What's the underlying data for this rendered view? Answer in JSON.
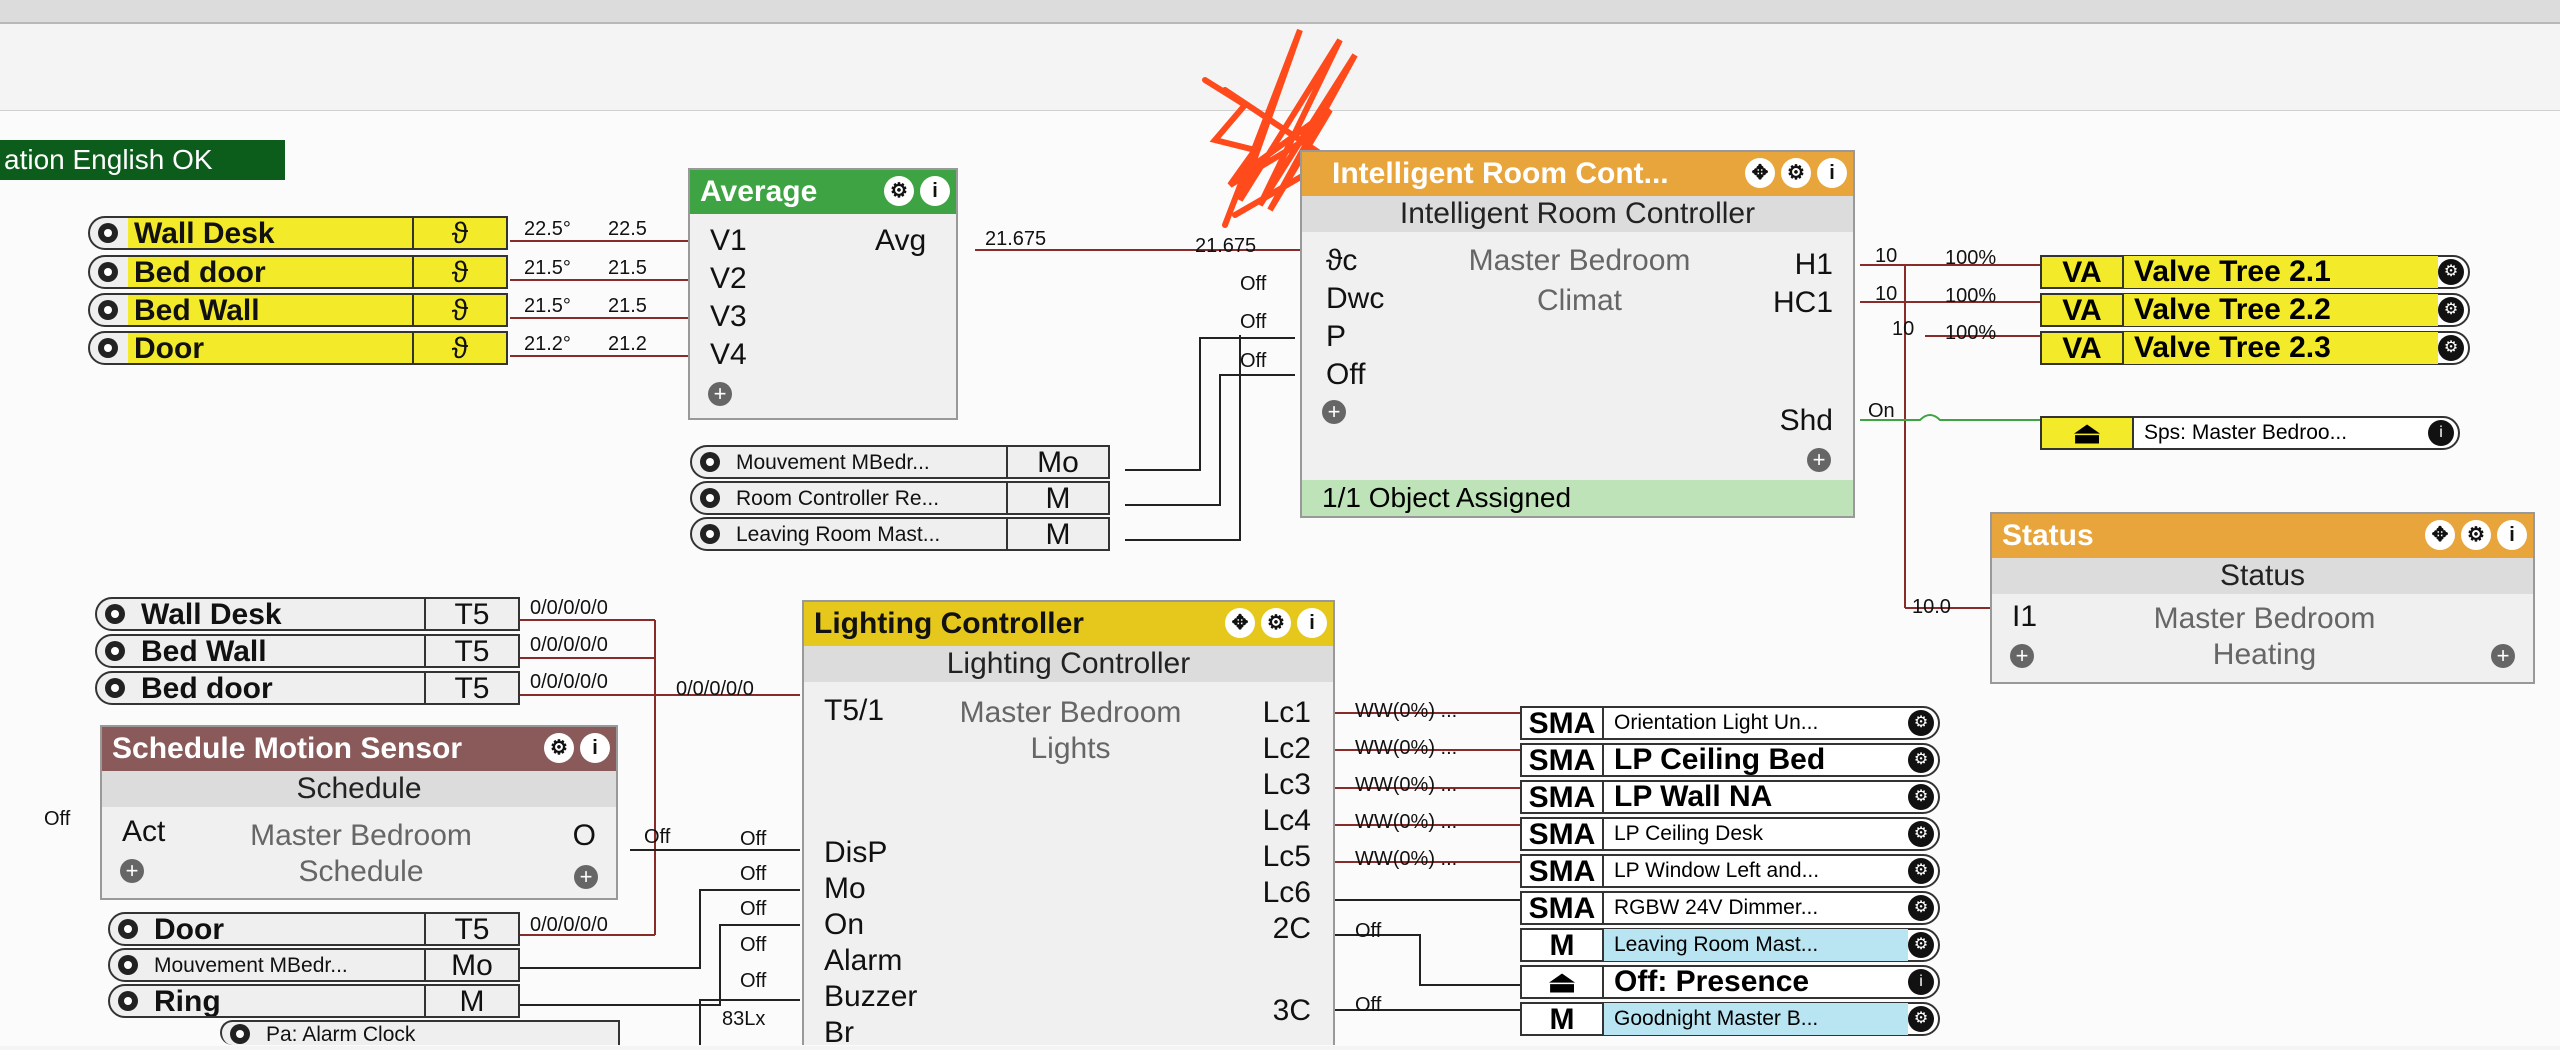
{
  "status_bar": "ation English OK",
  "temp_inputs": [
    {
      "label": "Wall Desk",
      "tag": "ϑ",
      "value": "22.5°",
      "out": "22.5"
    },
    {
      "label": "Bed door",
      "tag": "ϑ",
      "value": "21.5°",
      "out": "21.5"
    },
    {
      "label": "Bed Wall",
      "tag": "ϑ",
      "value": "21.5°",
      "out": "21.5"
    },
    {
      "label": "Door",
      "tag": "ϑ",
      "value": "21.2°",
      "out": "21.2"
    }
  ],
  "average": {
    "title": "Average",
    "inputs": [
      "V1",
      "V2",
      "V3",
      "V4"
    ],
    "output": "Avg",
    "value": "21.675"
  },
  "irc": {
    "title": "Intelligent Room Cont...",
    "subtitle": "Intelligent Room Controller",
    "room": "Master Bedroom",
    "category": "Climat",
    "inputs": [
      "ϑc",
      "Dwc",
      "P",
      "Off"
    ],
    "input_values": [
      "21.675",
      "Off",
      "Off",
      "Off"
    ],
    "outputs": [
      "H1",
      "HC1",
      "Shd"
    ],
    "footer": "1/1 Object Assigned",
    "h1_value": "10",
    "hc1_value": "10",
    "third_value": "10",
    "shd_value": "On"
  },
  "mode_inputs": [
    {
      "label": "Mouvement MBedr...",
      "tag": "Mo"
    },
    {
      "label": "Room Controller Re...",
      "tag": "M"
    },
    {
      "label": "Leaving Room Mast...",
      "tag": "M"
    }
  ],
  "valves": [
    {
      "tag": "VA",
      "label": "Valve Tree 2.1",
      "pct": "100%"
    },
    {
      "tag": "VA",
      "label": "Valve Tree 2.2",
      "pct": "100%"
    },
    {
      "tag": "VA",
      "label": "Valve Tree 2.3",
      "pct": "100%"
    }
  ],
  "sps_output": "Sps: Master Bedroo...",
  "status_block": {
    "title": "Status",
    "subtitle": "Status",
    "port": "I1",
    "room": "Master Bedroom",
    "value": "Heating",
    "input_value": "10.0"
  },
  "light_inputs": [
    {
      "label": "Wall Desk",
      "tag": "T5",
      "value": "0/0/0/0/0"
    },
    {
      "label": "Bed Wall",
      "tag": "T5",
      "value": "0/0/0/0/0"
    },
    {
      "label": "Bed door",
      "tag": "T5",
      "value": "0/0/0/0/0"
    }
  ],
  "schedule": {
    "title": "Schedule Motion Sensor",
    "subtitle": "Schedule",
    "port_in": "Act",
    "room": "Master Bedroom",
    "category": "Schedule",
    "port_out": "O",
    "in_value": "Off",
    "out_value": "Off"
  },
  "lower_inputs": [
    {
      "label": "Door",
      "tag": "T5",
      "value": "0/0/0/0/0"
    },
    {
      "label": "Mouvement MBedr...",
      "tag": "Mo"
    },
    {
      "label": "Ring",
      "tag": "M"
    }
  ],
  "lower_partial": "Pa: Alarm Clock",
  "lighting": {
    "title": "Lighting Controller",
    "subtitle": "Lighting Controller",
    "room": "Master Bedroom",
    "category": "Lights",
    "t5_port": "T5/1",
    "t5_value": "0/0/0/0/0",
    "inputs": [
      "DisP",
      "Mo",
      "On",
      "Alarm",
      "Buzzer",
      "Br"
    ],
    "input_values": [
      "Off",
      "Off",
      "Off",
      "Off",
      "Off",
      "83Lx"
    ],
    "outputs": [
      "Lc1",
      "Lc2",
      "Lc3",
      "Lc4",
      "Lc5",
      "Lc6",
      "2C",
      "3C"
    ],
    "output_values": [
      "WW(0%) ...",
      "WW(0%) ...",
      "WW(0%) ...",
      "WW(0%) ...",
      "WW(0%) ...",
      "",
      "Off",
      "Off"
    ]
  },
  "light_outputs": [
    {
      "tag": "SMA",
      "label": "Orientation Light Un..."
    },
    {
      "tag": "SMA",
      "label": "LP Ceiling Bed"
    },
    {
      "tag": "SMA",
      "label": "LP Wall NA"
    },
    {
      "tag": "SMA",
      "label": "LP Ceiling Desk"
    },
    {
      "tag": "SMA",
      "label": "LP Window Left and..."
    },
    {
      "tag": "SMA",
      "label": "RGBW 24V Dimmer..."
    },
    {
      "tag": "M",
      "label": "Leaving Room Mast..."
    },
    {
      "tag": "⏏",
      "label": "Off: Presence"
    },
    {
      "tag": "M",
      "label": "Goodnight Master B..."
    }
  ],
  "colors": {
    "green_header": "#3ea443",
    "orange_header": "#e8a53b",
    "yellow_header": "#e6c81d",
    "brown_header": "#8a5a5a",
    "wire": "#8a2b2b",
    "scribble": "#ff4a1c"
  }
}
